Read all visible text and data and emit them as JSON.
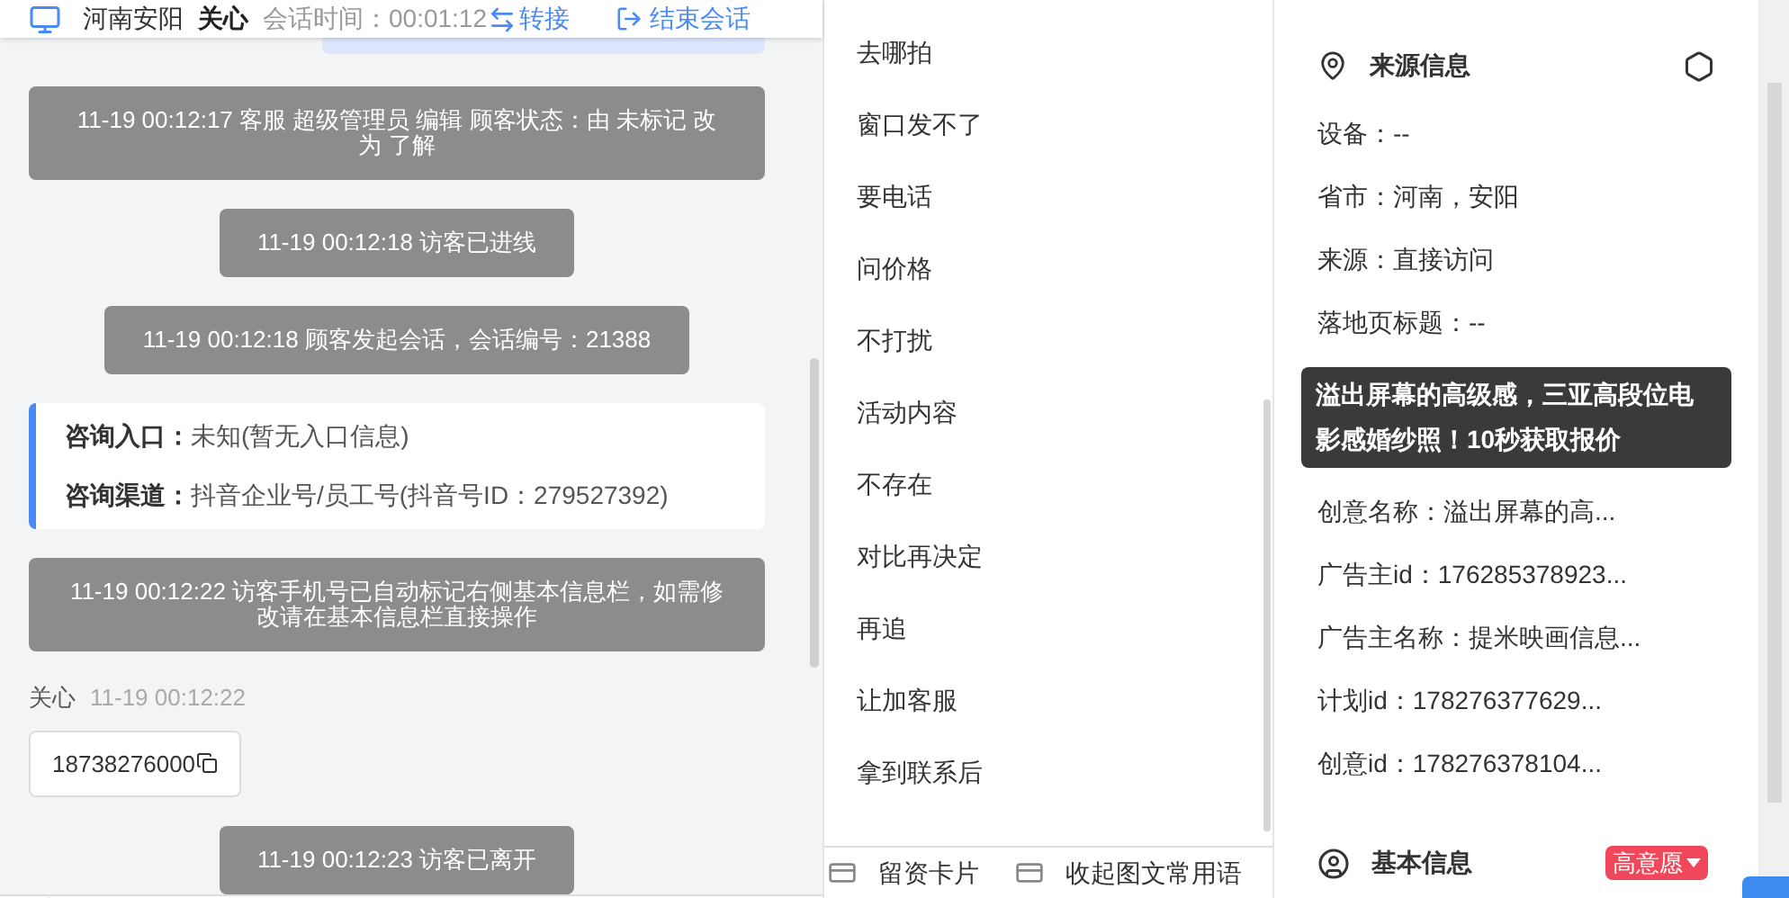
{
  "header": {
    "location": "河南安阳",
    "name": "关心",
    "session_label": "会话时间：",
    "session_time": "00:01:12",
    "transfer": "转接",
    "end": "结束会话"
  },
  "messages": [
    {
      "kind": "system",
      "text": "11-19 00:12:17 客服 超级管理员 编辑 顾客状态：由 未标记 改为 了解"
    },
    {
      "kind": "system",
      "text": "11-19 00:12:18 访客已进线"
    },
    {
      "kind": "system",
      "text": "11-19 00:12:18 顾客发起会话，会话编号：21388"
    },
    {
      "kind": "entry",
      "rows": [
        {
          "label": "咨询入口：",
          "value": "未知(暂无入口信息)"
        },
        {
          "label": "咨询渠道：",
          "value": "抖音企业号/员工号(抖音号ID：279527392)"
        }
      ]
    },
    {
      "kind": "system",
      "text": "11-19 00:12:22 访客手机号已自动标记右侧基本信息栏，如需修改请在基本信息栏直接操作"
    },
    {
      "kind": "visitor",
      "sender": "关心",
      "time": "11-19 00:12:22",
      "text": "18738276000"
    },
    {
      "kind": "system",
      "text": "11-19 00:12:23 访客已离开"
    }
  ],
  "phrases": [
    "去哪拍",
    "窗口发不了",
    "要电话",
    "问价格",
    "不打扰",
    "活动内容",
    "不存在",
    "对比再决定",
    "再追",
    "让加客服",
    "拿到联系后"
  ],
  "phrase_actions": [
    "留资卡片",
    "收起图文常用语"
  ],
  "source": {
    "title": "来源信息",
    "fields_top": [
      "设备：--",
      "省市：河南，安阳",
      "来源：直接访问",
      "落地页标题：--"
    ],
    "tooltip": "溢出屏幕的高级感，三亚高段位电影感婚纱照！10秒获取报价",
    "fields_bottom": [
      "创意名称：溢出屏幕的高...",
      "广告主id：176285378923...",
      "广告主名称：提米映画信息...",
      "计划id：178276377629...",
      "创意id：178276378104..."
    ]
  },
  "basic": {
    "title": "基本信息",
    "badge": "高意愿"
  }
}
